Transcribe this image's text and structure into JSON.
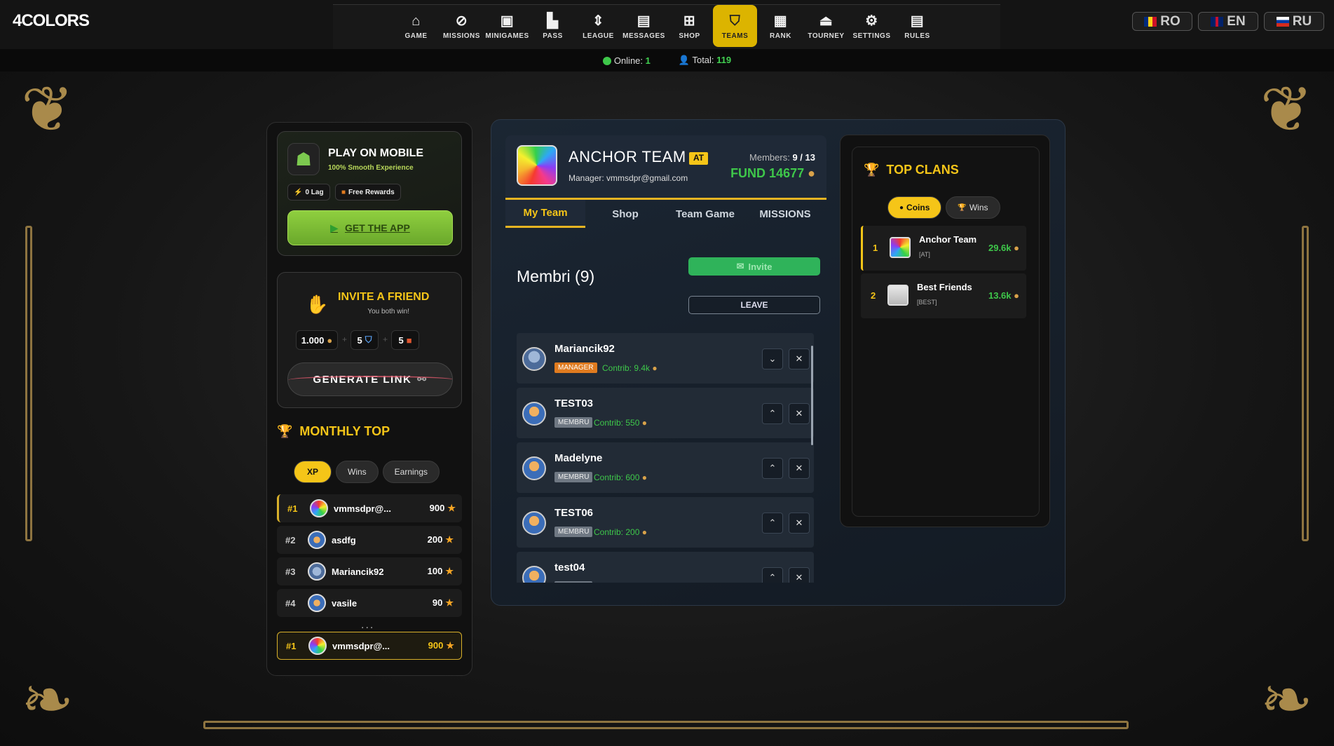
{
  "logo": "4COLORS",
  "nav": [
    {
      "label": "GAME",
      "icon": "home-icon",
      "glyph": "⌂"
    },
    {
      "label": "MISSIONS",
      "icon": "compass-icon",
      "glyph": "⊘"
    },
    {
      "label": "MINIGAMES",
      "icon": "gamepad-icon",
      "glyph": "▣"
    },
    {
      "label": "PASS",
      "icon": "factory-icon",
      "glyph": "▙"
    },
    {
      "label": "LEAGUE",
      "icon": "chevrons-icon",
      "glyph": "⇕"
    },
    {
      "label": "MESSAGES",
      "icon": "chat-icon",
      "glyph": "▤"
    },
    {
      "label": "SHOP",
      "icon": "cart-icon",
      "glyph": "⊞"
    },
    {
      "label": "TEAMS",
      "icon": "shield-icon",
      "glyph": "⛉"
    },
    {
      "label": "RANK",
      "icon": "id-badge-icon",
      "glyph": "▦"
    },
    {
      "label": "TOURNEY",
      "icon": "eject-icon",
      "glyph": "⏏"
    },
    {
      "label": "SETTINGS",
      "icon": "gear-icon",
      "glyph": "⚙"
    },
    {
      "label": "RULES",
      "icon": "document-icon",
      "glyph": "▤"
    }
  ],
  "active_nav": "TEAMS",
  "languages": [
    {
      "code": "RO",
      "flag_colors": [
        "#002b7f",
        "#fcd116",
        "#ce1126"
      ]
    },
    {
      "code": "EN",
      "flag_colors": [
        "#012169",
        "#ffffff",
        "#c8102e"
      ]
    },
    {
      "code": "RU",
      "flag_colors": [
        "#ffffff",
        "#0039a6",
        "#d52b1e"
      ]
    }
  ],
  "status": {
    "online_label": "Online:",
    "online_value": "1",
    "total_label": "Total:",
    "total_value": "119"
  },
  "mobile": {
    "title": "PLAY ON MOBILE",
    "subtitle": "100% Smooth Experience",
    "pill1": "0 Lag",
    "pill2": "Free Rewards",
    "button": "GET THE APP"
  },
  "invite": {
    "title": "INVITE A FRIEND",
    "subtitle": "You both win!",
    "reward1": "1.000",
    "reward2": "5",
    "reward3": "5",
    "button": "GENERATE LINK"
  },
  "monthly": {
    "title": "MONTHLY TOP",
    "tabs": [
      "XP",
      "Wins",
      "Earnings"
    ],
    "active_tab": "XP",
    "rows": [
      {
        "rank": "#1",
        "name": "vmmsdpr@...",
        "score": "900"
      },
      {
        "rank": "#2",
        "name": "asdfg",
        "score": "200"
      },
      {
        "rank": "#3",
        "name": "Mariancik92",
        "score": "100"
      },
      {
        "rank": "#4",
        "name": "vasile",
        "score": "90"
      }
    ],
    "dots": "...",
    "me": {
      "rank": "#1",
      "name": "vmmsdpr@...",
      "score": "900"
    }
  },
  "team": {
    "name": "ANCHOR TEAM",
    "tag": "AT",
    "manager": "Manager: vmmsdpr@gmail.com",
    "members_label": "Members:",
    "members_value": "9 / 13",
    "fund": "FUND 14677",
    "tabs": [
      "My Team",
      "Shop",
      "Team Game",
      "MISSIONS"
    ],
    "active_tab": "My Team",
    "members_title": "Membri (9)",
    "invite_button": "Invite",
    "leave_button": "LEAVE",
    "members": [
      {
        "name": "Mariancik92",
        "role": "MANAGER",
        "contrib": "Contrib: 9.4k",
        "ctl": "⌄"
      },
      {
        "name": "TEST03",
        "role": "MEMBRU",
        "contrib": "Contrib: 550",
        "ctl": "⌃"
      },
      {
        "name": "Madelyne",
        "role": "MEMBRU",
        "contrib": "Contrib: 600",
        "ctl": "⌃"
      },
      {
        "name": "TEST06",
        "role": "MEMBRU",
        "contrib": "Contrib: 200",
        "ctl": "⌃"
      },
      {
        "name": "test04",
        "role": "MEMBRU",
        "contrib": "",
        "ctl": "⌃"
      }
    ]
  },
  "topclans": {
    "title": "TOP CLANS",
    "tabs": [
      "Coins",
      "Wins"
    ],
    "active_tab": "Coins",
    "rows": [
      {
        "rank": "1",
        "name": "Anchor Team",
        "tag": "[AT]",
        "value": "29.6k"
      },
      {
        "rank": "2",
        "name": "Best Friends",
        "tag": "[BEST]",
        "value": "13.6k"
      }
    ]
  },
  "colors": {
    "accent": "#f5c518",
    "green": "#3ec74a",
    "orange": "#e07b1f"
  }
}
